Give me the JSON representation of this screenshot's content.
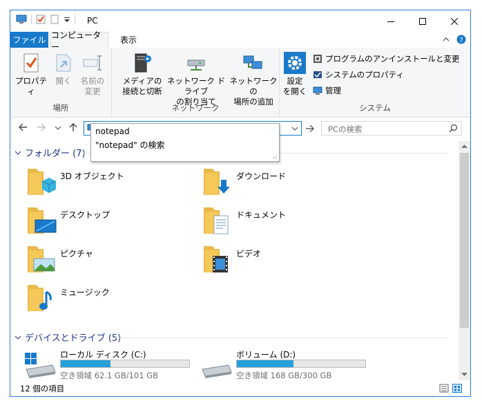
{
  "window": {
    "title": "PC"
  },
  "menu": {
    "file": "ファイル",
    "computer": "コンピューター",
    "view": "表示"
  },
  "ribbon": {
    "location": {
      "label": "場所",
      "properties": "プロパティ",
      "open": "開く",
      "rename_line1": "名前の",
      "rename_line2": "変更"
    },
    "network": {
      "label": "ネットワーク",
      "media_line1": "メディアの",
      "media_line2": "接続と切断",
      "drive_line1": "ネットワーク ドライブ",
      "drive_line2": "の割り当て",
      "location_line1": "ネットワークの",
      "location_line2": "場所の追加"
    },
    "system": {
      "label": "システム",
      "settings_line1": "設定",
      "settings_line2": "を開く",
      "uninstall": "プログラムのアンインストールと変更",
      "sysprops": "システムのプロパティ",
      "manage": "管理"
    }
  },
  "address": {
    "value": "notepad"
  },
  "search": {
    "placeholder": "PCの検索"
  },
  "autocomplete": {
    "item1": "notepad",
    "item2": "\"notepad\" の検索"
  },
  "folders": {
    "heading": "フォルダー (7)",
    "items": [
      "3D オブジェクト",
      "ダウンロード",
      "デスクトップ",
      "ドキュメント",
      "ピクチャ",
      "ビデオ",
      "ミュージック"
    ]
  },
  "devices": {
    "heading": "デバイスとドライブ (5)",
    "drives": [
      {
        "name": "ローカル ディスク (C:)",
        "info": "空き領域 62.1 GB/101 GB",
        "used_fraction": 0.385
      },
      {
        "name": "ボリューム (D:)",
        "info": "空き領域 168 GB/300 GB",
        "used_fraction": 0.44
      }
    ]
  },
  "status": {
    "count": "12 個の項目"
  },
  "colors": {
    "accent": "#1979ca",
    "drive_fill": "#26a0da",
    "folder": "#f5c85a",
    "heading": "#1e3287"
  }
}
